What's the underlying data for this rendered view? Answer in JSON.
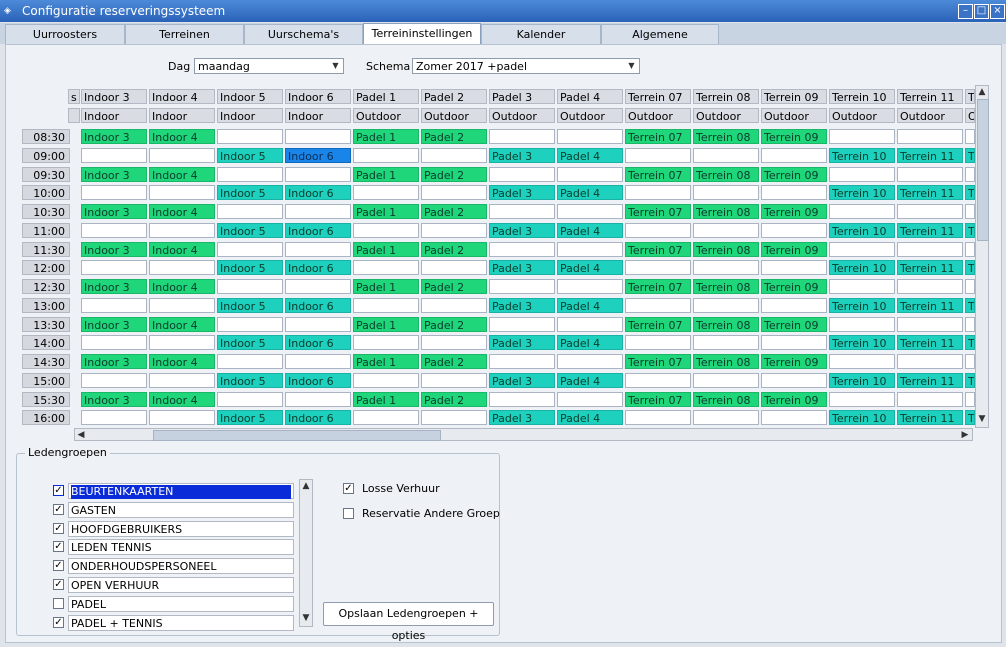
{
  "window": {
    "title": "Configuratie reserveringssysteem"
  },
  "tabs": [
    "Uurroosters",
    "Terreinen",
    "Uurschema's",
    "Terreininstellingen",
    "Kalender",
    "Algemene instellingen"
  ],
  "active_tab": "Terreininstellingen",
  "filters": {
    "dag_label": "Dag :",
    "dag_value": "maandag",
    "schema_label": "Schema :",
    "schema_value": "Zomer 2017 +padel"
  },
  "columns": [
    {
      "name": "s",
      "type": ""
    },
    {
      "name": "Indoor 3",
      "type": "Indoor"
    },
    {
      "name": "Indoor 4",
      "type": "Indoor"
    },
    {
      "name": "Indoor 5",
      "type": "Indoor"
    },
    {
      "name": "Indoor 6",
      "type": "Indoor"
    },
    {
      "name": "Padel 1",
      "type": "Outdoor"
    },
    {
      "name": "Padel 2",
      "type": "Outdoor"
    },
    {
      "name": "Padel 3",
      "type": "Outdoor"
    },
    {
      "name": "Padel 4",
      "type": "Outdoor"
    },
    {
      "name": "Terrein 07",
      "type": "Outdoor"
    },
    {
      "name": "Terrein 08",
      "type": "Outdoor"
    },
    {
      "name": "Terrein 09",
      "type": "Outdoor"
    },
    {
      "name": "Terrein 10",
      "type": "Outdoor"
    },
    {
      "name": "Terrein 11",
      "type": "Outdoor"
    },
    {
      "name": "T",
      "type": "O"
    }
  ],
  "times": [
    "08:30",
    "09:00",
    "09:30",
    "10:00",
    "10:30",
    "11:00",
    "11:30",
    "12:00",
    "12:30",
    "13:00",
    "13:30",
    "14:00",
    "14:30",
    "15:00",
    "15:30",
    "16:00"
  ],
  "row_patterns": {
    "A": [
      "",
      "Indoor 3",
      "Indoor 4",
      "",
      "",
      "Padel 1",
      "Padel 2",
      "",
      "",
      "Terrein 07",
      "Terrein 08",
      "Terrein 09",
      "",
      "",
      ""
    ],
    "B": [
      "",
      "",
      "",
      "Indoor 5",
      "Indoor 6",
      "",
      "",
      "Padel 3",
      "Padel 4",
      "",
      "",
      "",
      "Terrein 10",
      "Terrein 11",
      "T"
    ]
  },
  "selected_cell": {
    "time": "09:00",
    "label": "Indoor 6"
  },
  "members": {
    "legend": "Ledengroepen",
    "groups": [
      {
        "label": "BEURTENKAARTEN",
        "checked": true,
        "selected": true
      },
      {
        "label": "GASTEN",
        "checked": true
      },
      {
        "label": "HOOFDGEBRUIKERS",
        "checked": true
      },
      {
        "label": "LEDEN TENNIS",
        "checked": true
      },
      {
        "label": "ONDERHOUDSPERSONEEL",
        "checked": true
      },
      {
        "label": "OPEN VERHUUR",
        "checked": true
      },
      {
        "label": "PADEL",
        "checked": false
      },
      {
        "label": "PADEL + TENNIS",
        "checked": true
      }
    ],
    "options": [
      {
        "label": "Losse Verhuur",
        "checked": true
      },
      {
        "label": "Reservatie Andere Groep",
        "checked": false
      }
    ],
    "save_label": "Opslaan Ledengroepen + opties"
  },
  "colors": {
    "green": "#1fd67a",
    "teal": "#1ed0be",
    "selected": "#1a85e8",
    "titlebar": "#2a62b8"
  }
}
